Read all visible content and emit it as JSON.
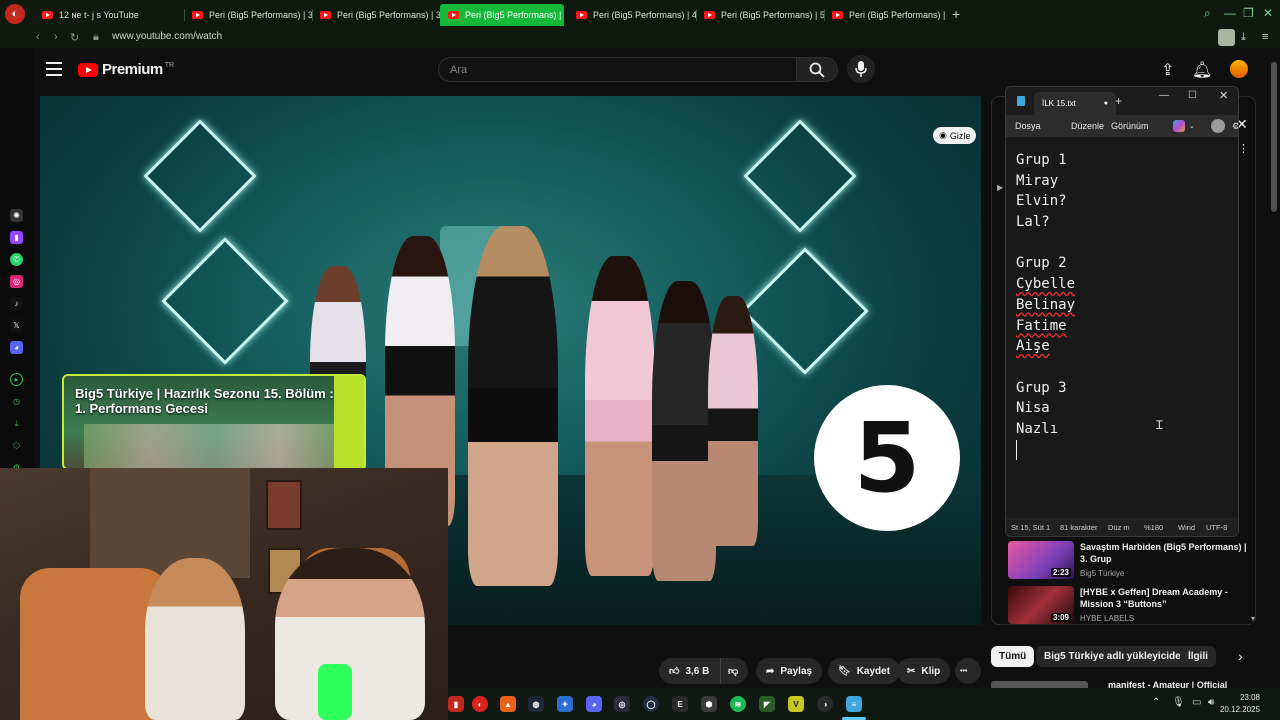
{
  "browser": {
    "tabs": [
      {
        "label": "12  ɴe t- j s  YouTube"
      },
      {
        "label": "Peri (Big5 Performans) | 3"
      },
      {
        "label": "Peri (Big5 Performans) | 3"
      },
      {
        "label": "Peri (Big5 Performans) |"
      },
      {
        "label": "Peri (Big5 Performans) | 4"
      },
      {
        "label": "Peri (Big5 Performans) | 5"
      },
      {
        "label": "Peri (Big5 Performans) | B"
      }
    ],
    "new_tab_glyph": "+",
    "url": "www.youtube.com/watch"
  },
  "youtube": {
    "logo_word": "Premium",
    "logo_region": "TR",
    "search_placeholder": "Ara",
    "video": {
      "hide_label": "Gizle",
      "endcard_title": "Big5 Türkiye | Hazırlık Sezonu 15. Bölüm : 1. Performans Gecesi",
      "logo_glyph": "5"
    },
    "actions": {
      "like_count": "3,6 B",
      "share_label": "Paylaş",
      "save_label": "Kaydet",
      "clip_label": "Klip",
      "more_glyph": "•••"
    },
    "recommendations": [
      {
        "title": "Savaştım Harbiden (Big5 Performans) | 3. Grup",
        "channel": "Big5 Türkiye",
        "duration": "2:23"
      },
      {
        "title": "[HYBE x Geffen] Dream Academy - Mission 3 “Buttons”",
        "channel": "HYBE LABELS",
        "duration": "3:09"
      }
    ],
    "chips": [
      "Tümü",
      "Big5 Türkiye adlı yükleyiciden",
      "İlgili"
    ],
    "next_item_title": "manifest - Amateur | Official"
  },
  "notepad": {
    "tab_title": "İLK 15.txt",
    "menu": [
      "Dosya",
      "Düzenle",
      "Görünüm"
    ],
    "lines": [
      "Grup 1",
      "Miray",
      "Elvin?",
      "Lal?",
      "",
      "Grup 2",
      "Cybelle",
      "Belinay",
      "Fatime",
      "Aişe",
      "",
      "Grup 3",
      "Nisa",
      "Nazlı",
      ""
    ],
    "spell_error_lines": [
      6,
      7,
      8,
      9
    ],
    "status": {
      "position": "St 15, Süt 1",
      "chars": "81 karakter",
      "mode": "Düz m",
      "zoom": "%180",
      "eol": "Wind",
      "encoding": "UTF-8"
    }
  },
  "taskbar": {
    "time": "23:08",
    "date": "20.12.2025"
  },
  "colors": {
    "active_tab": "#16b83a",
    "youtube_red": "#ff0000",
    "endcard_accent": "#c6ea3a"
  }
}
